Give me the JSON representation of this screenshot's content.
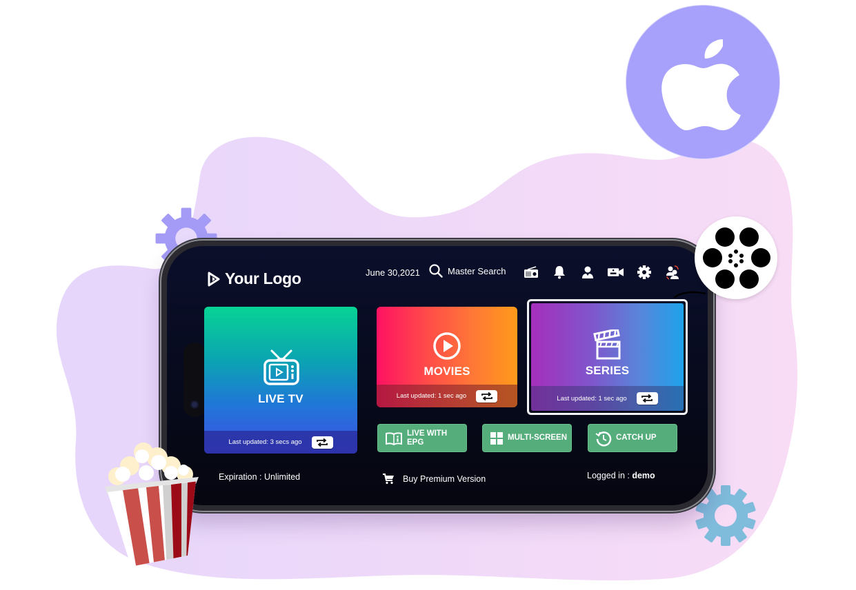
{
  "header": {
    "logo_text": "Your Logo",
    "date": "June 30,2021",
    "search_label": "Master Search",
    "icons": [
      "radio-icon",
      "bell-icon",
      "user-icon",
      "record-camera-icon",
      "gear-icon",
      "switch-user-icon"
    ]
  },
  "cards": {
    "live_tv": {
      "label": "LIVE TV",
      "last_updated": "Last updated: 3 secs ago"
    },
    "movies": {
      "label": "MOVIES",
      "last_updated": "Last updated: 1 sec ago"
    },
    "series": {
      "label": "SERIES",
      "last_updated": "Last updated: 1 sec ago"
    }
  },
  "quick_buttons": [
    {
      "line1": "LIVE WITH",
      "line2": "EPG"
    },
    {
      "line1": "MULTI-SCREEN"
    },
    {
      "line1": "CATCH UP"
    }
  ],
  "footer": {
    "expiration": "Expiration : Unlimited",
    "buy_premium": "Buy Premium Version",
    "logged_in_label": "Logged in : ",
    "logged_in_user": "demo"
  },
  "colors": {
    "screen_bg": "#070a1c",
    "live_tv_gradient": [
      "#08d394",
      "#3d4fe6"
    ],
    "movies_gradient": [
      "#ff1262",
      "#ff9a1a"
    ],
    "series_gradient": [
      "#a62fbc",
      "#1ea2ea"
    ],
    "action_green": "#54ad7b",
    "apple_badge": "#a7a1fc",
    "blob_lavender": "#e6d6fb",
    "blob_pink": "#f6dcf6"
  }
}
